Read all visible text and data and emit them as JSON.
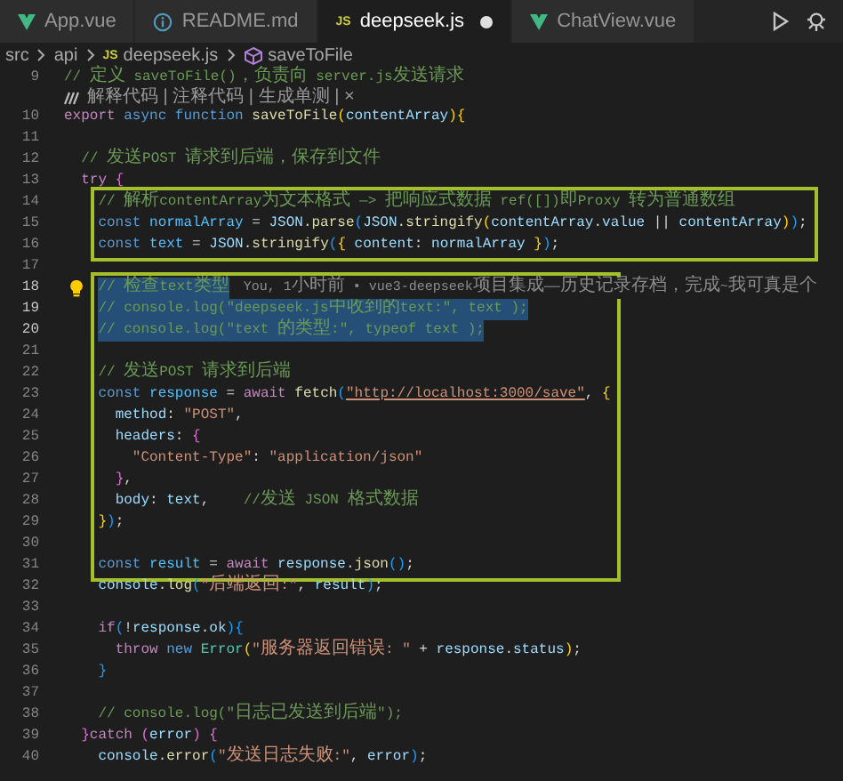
{
  "tabs": [
    {
      "label": "App.vue",
      "kind": "vue",
      "selected": false,
      "modified": false
    },
    {
      "label": "README.md",
      "kind": "markdown",
      "selected": false,
      "modified": false
    },
    {
      "label": "deepseek.js",
      "kind": "js",
      "badge": "JS",
      "selected": true,
      "modified": true
    },
    {
      "label": "ChatView.vue",
      "kind": "vue",
      "selected": false,
      "modified": false
    }
  ],
  "breadcrumbs": [
    {
      "text": "src",
      "kind": "folder"
    },
    {
      "text": "api",
      "kind": "folder"
    },
    {
      "text": "deepseek.js",
      "kind": "file",
      "badge": "JS"
    },
    {
      "text": "saveToFile",
      "kind": "symbol"
    }
  ],
  "code": [
    {
      "kind": "plain",
      "lines": [
        {
          "kind": "code",
          "number": "9",
          "selected": false,
          "lightbulb": false,
          "tokens": [
            {
              "kind": "comment",
              "text": "// 定义 saveToFile()，负责向 server.js发送请求"
            }
          ]
        },
        {
          "kind": "codelens",
          "text": "解释代码 | 注释代码 | 生成单测 | ×"
        },
        {
          "kind": "code",
          "number": "10",
          "selected": false,
          "lightbulb": false,
          "tokens": [
            {
              "kind": "control",
              "text": "export"
            },
            {
              "kind": "keyword",
              "text": " async"
            },
            {
              "kind": "keyword",
              "text": " function"
            },
            {
              "kind": "function",
              "text": " saveToFile"
            },
            {
              "kind": "bracket1",
              "text": "("
            },
            {
              "kind": "variable",
              "text": "contentArray"
            },
            {
              "kind": "bracket1",
              "text": "){"
            }
          ]
        },
        {
          "kind": "code",
          "number": "11",
          "selected": false,
          "lightbulb": false
        },
        {
          "kind": "code",
          "number": "12",
          "selected": false,
          "lightbulb": false,
          "tokens": [
            {
              "kind": "comment",
              "text": "  // 发送POST 请求到后端，保存到文件"
            }
          ]
        },
        {
          "kind": "code",
          "number": "13",
          "selected": false,
          "lightbulb": false,
          "tokens": [
            {
              "kind": "control",
              "text": "  try"
            },
            {
              "kind": "bracket2",
              "text": " {"
            }
          ]
        }
      ]
    },
    {
      "kind": "boxed",
      "lines": [
        {
          "kind": "code",
          "number": "14",
          "selected": false,
          "lightbulb": false,
          "tokens": [
            {
              "kind": "comment",
              "text": "    // 解析contentArray为文本格式 —> 把响应式数据 ref([])即Proxy 转为普通数组"
            }
          ]
        },
        {
          "kind": "code",
          "number": "15",
          "selected": false,
          "lightbulb": false,
          "tokens": [
            {
              "kind": "keyword",
              "text": "    const"
            },
            {
              "kind": "constant",
              "text": " normalArray"
            },
            {
              "kind": "plain",
              "text": " = "
            },
            {
              "kind": "variable",
              "text": "JSON"
            },
            {
              "kind": "plain",
              "text": "."
            },
            {
              "kind": "function",
              "text": "parse"
            },
            {
              "kind": "bracket3",
              "text": "("
            },
            {
              "kind": "variable",
              "text": "JSON"
            },
            {
              "kind": "plain",
              "text": "."
            },
            {
              "kind": "function",
              "text": "stringify"
            },
            {
              "kind": "bracket1",
              "text": "("
            },
            {
              "kind": "variable",
              "text": "contentArray"
            },
            {
              "kind": "plain",
              "text": "."
            },
            {
              "kind": "variable",
              "text": "value"
            },
            {
              "kind": "plain",
              "text": " || "
            },
            {
              "kind": "variable",
              "text": "contentArray"
            },
            {
              "kind": "bracket1",
              "text": ")"
            },
            {
              "kind": "bracket3",
              "text": ")"
            },
            {
              "kind": "plain",
              "text": ";"
            }
          ]
        },
        {
          "kind": "code",
          "number": "16",
          "selected": false,
          "lightbulb": false,
          "tokens": [
            {
              "kind": "keyword",
              "text": "    const"
            },
            {
              "kind": "constant",
              "text": " text"
            },
            {
              "kind": "plain",
              "text": " = "
            },
            {
              "kind": "variable",
              "text": "JSON"
            },
            {
              "kind": "plain",
              "text": "."
            },
            {
              "kind": "function",
              "text": "stringify"
            },
            {
              "kind": "bracket3",
              "text": "("
            },
            {
              "kind": "bracket1",
              "text": "{"
            },
            {
              "kind": "variable",
              "text": " content"
            },
            {
              "kind": "plain",
              "text": ": "
            },
            {
              "kind": "variable",
              "text": "normalArray"
            },
            {
              "kind": "bracket1",
              "text": " }"
            },
            {
              "kind": "bracket3",
              "text": ")"
            },
            {
              "kind": "plain",
              "text": ";"
            }
          ]
        }
      ]
    },
    {
      "kind": "plain",
      "lines": [
        {
          "kind": "code",
          "number": "17",
          "selected": false,
          "lightbulb": false
        }
      ]
    },
    {
      "kind": "boxed",
      "lines": [
        {
          "kind": "code",
          "number": "18",
          "selected": true,
          "lightbulb": true,
          "blame": "You, 1小时前 • vue3-deepseek项目集成——历史记录存档，完成~我可真是个",
          "tokens": [
            {
              "kind": "comment",
              "text": "    // 检查text类型"
            }
          ]
        },
        {
          "kind": "code",
          "number": "19",
          "selected": true,
          "lightbulb": false,
          "tokens": [
            {
              "kind": "comment",
              "text": "    // console.log(\"deepseek.js中收到的text:\", text );"
            }
          ]
        },
        {
          "kind": "code",
          "number": "20",
          "selected": true,
          "lightbulb": false,
          "tokens": [
            {
              "kind": "comment",
              "text": "    // console.log(\"text 的类型:\", typeof text );"
            }
          ]
        },
        {
          "kind": "code",
          "number": "21",
          "selected": false,
          "lightbulb": false
        },
        {
          "kind": "code",
          "number": "22",
          "selected": false,
          "lightbulb": false,
          "tokens": [
            {
              "kind": "comment",
              "text": "    // 发送POST 请求到后端"
            }
          ]
        },
        {
          "kind": "code",
          "number": "23",
          "selected": false,
          "lightbulb": false,
          "tokens": [
            {
              "kind": "keyword",
              "text": "    const"
            },
            {
              "kind": "constant",
              "text": " response"
            },
            {
              "kind": "plain",
              "text": " = "
            },
            {
              "kind": "control",
              "text": "await"
            },
            {
              "kind": "function",
              "text": " fetch"
            },
            {
              "kind": "bracket3",
              "text": "("
            },
            {
              "kind": "url",
              "text": "\"http://localhost:3000/save\""
            },
            {
              "kind": "plain",
              "text": ", "
            },
            {
              "kind": "bracket1",
              "text": "{"
            }
          ]
        },
        {
          "kind": "code",
          "number": "24",
          "selected": false,
          "lightbulb": false,
          "tokens": [
            {
              "kind": "variable",
              "text": "      method"
            },
            {
              "kind": "plain",
              "text": ": "
            },
            {
              "kind": "string",
              "text": "\"POST\""
            },
            {
              "kind": "plain",
              "text": ","
            }
          ]
        },
        {
          "kind": "code",
          "number": "25",
          "selected": false,
          "lightbulb": false,
          "tokens": [
            {
              "kind": "variable",
              "text": "      headers"
            },
            {
              "kind": "plain",
              "text": ": "
            },
            {
              "kind": "bracket2",
              "text": "{"
            }
          ]
        },
        {
          "kind": "code",
          "number": "26",
          "selected": false,
          "lightbulb": false,
          "tokens": [
            {
              "kind": "string",
              "text": "        \"Content-Type\""
            },
            {
              "kind": "plain",
              "text": ": "
            },
            {
              "kind": "string",
              "text": "\"application/json\""
            }
          ]
        },
        {
          "kind": "code",
          "number": "27",
          "selected": false,
          "lightbulb": false,
          "tokens": [
            {
              "kind": "bracket2",
              "text": "      }"
            },
            {
              "kind": "plain",
              "text": ","
            }
          ]
        },
        {
          "kind": "code",
          "number": "28",
          "selected": false,
          "lightbulb": false,
          "tokens": [
            {
              "kind": "variable",
              "text": "      body"
            },
            {
              "kind": "plain",
              "text": ": "
            },
            {
              "kind": "variable",
              "text": "text"
            },
            {
              "kind": "plain",
              "text": ","
            },
            {
              "kind": "comment",
              "text": "    //发送 JSON 格式数据"
            }
          ]
        },
        {
          "kind": "code",
          "number": "29",
          "selected": false,
          "lightbulb": false,
          "tokens": [
            {
              "kind": "bracket1",
              "text": "    }"
            },
            {
              "kind": "bracket3",
              "text": ")"
            },
            {
              "kind": "plain",
              "text": ";"
            }
          ]
        },
        {
          "kind": "code",
          "number": "30",
          "selected": false,
          "lightbulb": false
        },
        {
          "kind": "code",
          "number": "31",
          "selected": false,
          "lightbulb": false,
          "tokens": [
            {
              "kind": "keyword",
              "text": "    const"
            },
            {
              "kind": "constant",
              "text": " result"
            },
            {
              "kind": "plain",
              "text": " = "
            },
            {
              "kind": "control",
              "text": "await"
            },
            {
              "kind": "variable",
              "text": " response"
            },
            {
              "kind": "plain",
              "text": "."
            },
            {
              "kind": "function",
              "text": "json"
            },
            {
              "kind": "bracket3",
              "text": "()"
            },
            {
              "kind": "plain",
              "text": ";"
            }
          ]
        }
      ]
    },
    {
      "kind": "plain",
      "lines": [
        {
          "kind": "code",
          "number": "32",
          "selected": false,
          "lightbulb": false,
          "tokens": [
            {
              "kind": "variable",
              "text": "    console"
            },
            {
              "kind": "plain",
              "text": "."
            },
            {
              "kind": "function",
              "text": "log"
            },
            {
              "kind": "bracket3",
              "text": "("
            },
            {
              "kind": "string",
              "text": "\"后端返回:\""
            },
            {
              "kind": "plain",
              "text": ", "
            },
            {
              "kind": "variable",
              "text": "result"
            },
            {
              "kind": "bracket3",
              "text": ")"
            },
            {
              "kind": "plain",
              "text": ";"
            }
          ]
        },
        {
          "kind": "code",
          "number": "33",
          "selected": false,
          "lightbulb": false
        },
        {
          "kind": "code",
          "number": "34",
          "selected": false,
          "lightbulb": false,
          "tokens": [
            {
              "kind": "control",
              "text": "    if"
            },
            {
              "kind": "bracket3",
              "text": "("
            },
            {
              "kind": "plain",
              "text": "!"
            },
            {
              "kind": "variable",
              "text": "response"
            },
            {
              "kind": "plain",
              "text": "."
            },
            {
              "kind": "variable",
              "text": "ok"
            },
            {
              "kind": "bracket3",
              "text": ")"
            },
            {
              "kind": "bracket3",
              "text": "{"
            }
          ]
        },
        {
          "kind": "code",
          "number": "35",
          "selected": false,
          "lightbulb": false,
          "tokens": [
            {
              "kind": "control",
              "text": "      throw"
            },
            {
              "kind": "keyword",
              "text": " new"
            },
            {
              "kind": "type",
              "text": " Error"
            },
            {
              "kind": "bracket1",
              "text": "("
            },
            {
              "kind": "string",
              "text": "\"服务器返回错误: \""
            },
            {
              "kind": "plain",
              "text": " + "
            },
            {
              "kind": "variable",
              "text": "response"
            },
            {
              "kind": "plain",
              "text": "."
            },
            {
              "kind": "variable",
              "text": "status"
            },
            {
              "kind": "bracket1",
              "text": ")"
            },
            {
              "kind": "plain",
              "text": ";"
            }
          ]
        },
        {
          "kind": "code",
          "number": "36",
          "selected": false,
          "lightbulb": false,
          "tokens": [
            {
              "kind": "bracket3",
              "text": "    }"
            }
          ]
        },
        {
          "kind": "code",
          "number": "37",
          "selected": false,
          "lightbulb": false
        },
        {
          "kind": "code",
          "number": "38",
          "selected": false,
          "lightbulb": false,
          "tokens": [
            {
              "kind": "comment",
              "text": "    // console.log(\"日志已发送到后端\");"
            }
          ]
        },
        {
          "kind": "code",
          "number": "39",
          "selected": false,
          "lightbulb": false,
          "tokens": [
            {
              "kind": "bracket2",
              "text": "  }"
            },
            {
              "kind": "control",
              "text": "catch"
            },
            {
              "kind": "bracket2",
              "text": " ("
            },
            {
              "kind": "variable",
              "text": "error"
            },
            {
              "kind": "bracket2",
              "text": ")"
            },
            {
              "kind": "bracket2",
              "text": " {"
            }
          ]
        },
        {
          "kind": "code",
          "number": "40",
          "selected": false,
          "lightbulb": false,
          "tokens": [
            {
              "kind": "variable",
              "text": "    console"
            },
            {
              "kind": "plain",
              "text": "."
            },
            {
              "kind": "function",
              "text": "error"
            },
            {
              "kind": "bracket3",
              "text": "("
            },
            {
              "kind": "string",
              "text": "\"发送日志失败:\""
            },
            {
              "kind": "plain",
              "text": ", "
            },
            {
              "kind": "variable",
              "text": "error"
            },
            {
              "kind": "bracket3",
              "text": ")"
            },
            {
              "kind": "plain",
              "text": ";"
            }
          ]
        }
      ]
    }
  ]
}
